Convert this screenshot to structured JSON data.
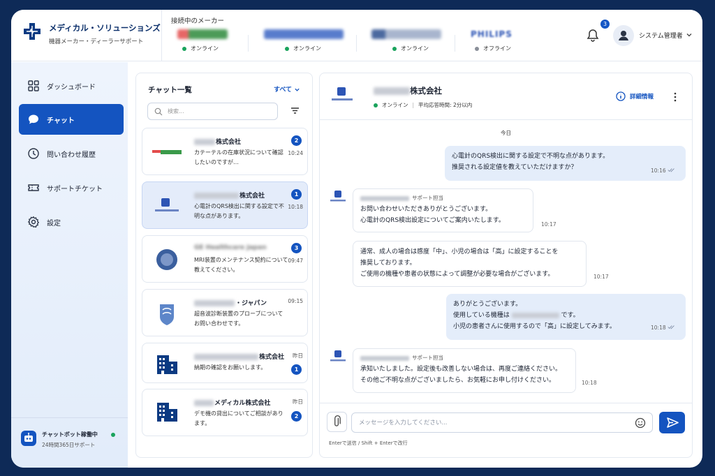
{
  "brand": {
    "name": "メディカル・ソリューションズ",
    "subtitle": "機器メーカー・ディーラーサポート"
  },
  "header": {
    "connected_title": "接続中のメーカー",
    "makers": [
      {
        "status": "オンライン",
        "status_color": "#1aa35c"
      },
      {
        "status": "オンライン",
        "status_color": "#1aa35c"
      },
      {
        "status": "オンライン",
        "status_color": "#1aa35c"
      },
      {
        "name": "PHILIPS",
        "status": "オフライン",
        "status_color": "#8a8f99"
      }
    ],
    "notification_count": "3",
    "user": "システム管理者"
  },
  "sidebar": {
    "items": [
      {
        "label": "ダッシュボード",
        "icon": "grid-icon"
      },
      {
        "label": "チャット",
        "icon": "chat-bubble-icon",
        "active": true
      },
      {
        "label": "問い合わせ履歴",
        "icon": "clock-icon"
      },
      {
        "label": "サポートチケット",
        "icon": "ticket-icon"
      },
      {
        "label": "設定",
        "icon": "gear-icon"
      }
    ],
    "bot": {
      "title": "チャットボット稼働中",
      "subtitle": "24時間365日サポート"
    }
  },
  "chat_list": {
    "title": "チャット一覧",
    "filter": "すべて",
    "search_placeholder": "検索...",
    "items": [
      {
        "name_suffix": "株式会社",
        "message": "カテーテルの在庫状況について確認したいのですが…",
        "time": "10:24",
        "unread": "2"
      },
      {
        "name_suffix": "株式会社",
        "message": "心電計のQRS検出に関する設定で不明な点があります。",
        "time": "10:18",
        "unread": "1",
        "selected": true
      },
      {
        "name": "GE Healthcare Japan",
        "message": "MRI装置のメンテナンス契約について教えてください。",
        "time": "09:47",
        "unread": "3"
      },
      {
        "name_suffix": "・ジャパン",
        "message": "超音波診断装置のプローブについてお問い合わせです。",
        "time": "09:15"
      },
      {
        "name_suffix": "株式会社",
        "message": "納期の確認をお願いします。",
        "time": "昨日",
        "unread": "1"
      },
      {
        "name_suffix": "メディカル株式会社",
        "message": "デモ機の貸出についてご相談があります。",
        "time": "昨日",
        "unread": "2"
      }
    ]
  },
  "chat": {
    "name_suffix": "株式会社",
    "status": "オンライン",
    "status_color": "#1aa35c",
    "response_time": "平均応答時間: 2分以内",
    "details_label": "詳細情報",
    "date_label": "今日",
    "messages": [
      {
        "from": "me",
        "lines": [
          "心電計のQRS検出に関する設定で不明な点があります。",
          "推奨される設定値を教えていただけますか？"
        ],
        "time": "10:16"
      },
      {
        "from": "them",
        "sender_role": "サポート担当",
        "lines": [
          "お問い合わせいただきありがとうございます。",
          "心電計のQRS検出設定についてご案内いたします。"
        ],
        "time": "10:17"
      },
      {
        "from": "them",
        "lines": [
          "通常、成人の場合は感度「中」、小児の場合は「高」に設定することを",
          "推奨しております。",
          "ご使用の機種や患者の状態によって調整が必要な場合がございます。"
        ],
        "time": "10:17"
      },
      {
        "from": "me",
        "lines": [
          "ありがとうございます。",
          "使用している機種は",
          "です。",
          "小児の患者さんに使用するので「高」に設定してみます。"
        ],
        "time": "10:18"
      },
      {
        "from": "them",
        "sender_role": "サポート担当",
        "lines": [
          "承知いたしました。設定後も改善しない場合は、再度ご連絡ください。",
          "その他ご不明な点がございましたら、お気軽にお申し付けください。"
        ],
        "time": "10:18"
      }
    ],
    "input_placeholder": "メッセージを入力してください...",
    "hint": "Enterで送信 / Shift + Enterで改行"
  }
}
